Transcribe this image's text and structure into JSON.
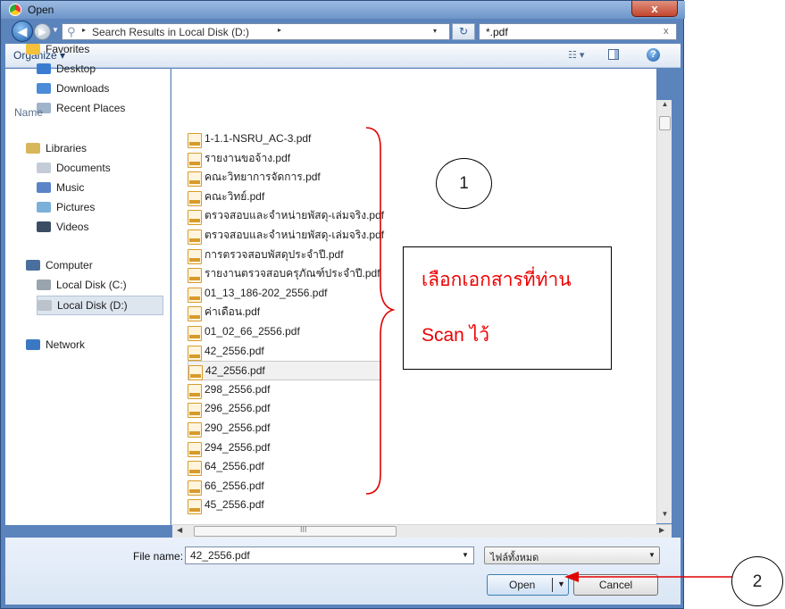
{
  "window": {
    "title": "Open",
    "close_label": "x"
  },
  "address": {
    "chevron": "▸",
    "path": "Search Results in Local Disk (D:)",
    "dropdown": "▾",
    "refresh_label": "↻",
    "search_value": "*.pdf",
    "search_clear": "x"
  },
  "toolbar": {
    "organize_label": "Organize ▾",
    "views_label": "☷ ▾",
    "help_label": "?"
  },
  "nav": {
    "favorites": [
      {
        "label": "Favorites",
        "icon": "star-icon",
        "color": "#f3c13a"
      },
      {
        "label": "Desktop",
        "icon": "desktop-icon",
        "color": "#3a7dd0"
      },
      {
        "label": "Downloads",
        "icon": "downloads-icon",
        "color": "#4c8bd6"
      },
      {
        "label": "Recent Places",
        "icon": "recent-places-icon",
        "color": "#9fb3cb"
      }
    ],
    "libraries": [
      {
        "label": "Libraries",
        "icon": "libraries-icon",
        "color": "#d8b65a"
      },
      {
        "label": "Documents",
        "icon": "documents-icon",
        "color": "#c4ccd8"
      },
      {
        "label": "Music",
        "icon": "music-icon",
        "color": "#5b83c7"
      },
      {
        "label": "Pictures",
        "icon": "pictures-icon",
        "color": "#7bb0d9"
      },
      {
        "label": "Videos",
        "icon": "videos-icon",
        "color": "#3c4d63"
      }
    ],
    "computer": [
      {
        "label": "Computer",
        "icon": "computer-icon",
        "color": "#4a6f9c"
      },
      {
        "label": "Local Disk (C:)",
        "icon": "drive-c-icon",
        "color": "#9aa4ae"
      },
      {
        "label": "Local Disk (D:)",
        "icon": "drive-d-icon",
        "color": "#bcc3cb",
        "selected": true
      }
    ],
    "network": [
      {
        "label": "Network",
        "icon": "network-icon",
        "color": "#3b78c2"
      }
    ]
  },
  "files": {
    "column_header": "Name",
    "items": [
      "1-1.1-NSRU_AC-3.pdf",
      "รายงานขอจ้าง.pdf",
      "คณะวิทยาการจัดการ.pdf",
      "คณะวิทย์.pdf",
      "ตรวจสอบและจำหน่ายพัสดุ-เล่มจริง.pdf",
      "ตรวจสอบและจำหน่ายพัสดุ-เล่มจริง.pdf",
      "การตรวจสอบพัสดุประจำปี.pdf",
      "รายงานตรวจสอบครุภัณฑ์ประจำปี.pdf",
      "01_13_186-202_2556.pdf",
      "ค่าเดือน.pdf",
      "01_02_66_2556.pdf",
      "42_2556.pdf",
      "42_2556.pdf",
      "298_2556.pdf",
      "296_2556.pdf",
      "290_2556.pdf",
      "294_2556.pdf",
      "64_2556.pdf",
      "66_2556.pdf",
      "45_2556.pdf"
    ],
    "selected_index": 12
  },
  "scroll": {
    "up": "▲",
    "down": "▼",
    "left": "◀",
    "right": "▶",
    "grip": "III"
  },
  "bottom": {
    "file_name_label": "File name:",
    "file_name_value": "42_2556.pdf",
    "file_type_value": "ไฟล์ทั้งหมด",
    "open_label": "Open",
    "open_drop": "▼",
    "cancel_label": "Cancel",
    "drop": "▼"
  },
  "annotations": {
    "callout_1": "1",
    "callout_2": "2",
    "note_line1": "เลือกเอกสารที่ท่าน",
    "note_line2": "Scan ไว้",
    "note_color": "#e00000"
  }
}
